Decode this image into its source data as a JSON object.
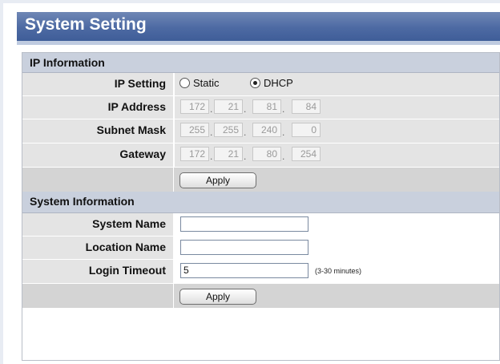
{
  "page_title": "System Setting",
  "ip_section": {
    "title": "IP Information",
    "ip_setting_label": "IP Setting",
    "static_label": "Static",
    "dhcp_label": "DHCP",
    "selected_mode": "DHCP",
    "ip_address_label": "IP Address",
    "ip_address": [
      "172",
      "21",
      "81",
      "84"
    ],
    "subnet_label": "Subnet Mask",
    "subnet": [
      "255",
      "255",
      "240",
      "0"
    ],
    "gateway_label": "Gateway",
    "gateway": [
      "172",
      "21",
      "80",
      "254"
    ],
    "apply_label": "Apply"
  },
  "system_section": {
    "title": "System Information",
    "system_name_label": "System Name",
    "system_name_value": "",
    "location_label": "Location Name",
    "location_value": "",
    "timeout_label": "Login Timeout",
    "timeout_value": "5",
    "timeout_hint": "(3-30 minutes)",
    "apply_label": "Apply"
  },
  "colors": {
    "title_bar": "#4d6aa3",
    "section_header": "#c9d0dd",
    "row_bg": "#e4e4e4"
  }
}
